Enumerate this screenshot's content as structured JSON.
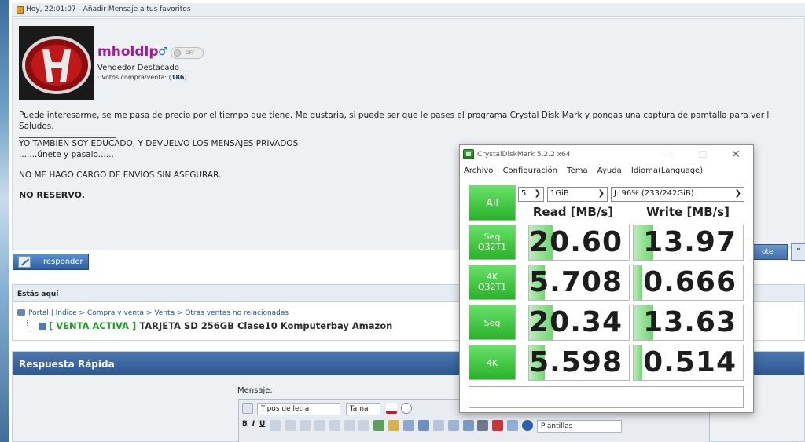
{
  "post": {
    "timestamp": "Hoy, 22:01:07 - Añadir Mensaje a tus favoritos",
    "username": "mholdlp",
    "gender_symbol": "♂",
    "online_status": "OFF",
    "user_title": "Vendedor Destacado",
    "votes_label": "· Votos compra/venta: (",
    "votes_count": "186",
    "votes_close": ")",
    "body_line1": "Puede interesarme, se me pasa de precio por el tiempo que tiene. Me gustaria, si puede ser que le pases el programa Crystal Disk Mark y pongas una captura de pamtalla para ver l",
    "body_line2": "Saludos.",
    "sig_line1": "YO TAMBIÉN SOY EDUCADO, Y DEVUELVO LOS MENSAJES PRIVADOS",
    "sig_line2": ".......únete y pasalo......",
    "sig_line3": "NO ME HAGO CARGO DE ENVÍOS SIN ASEGURAR.",
    "sig_line4": "NO RESERVO.",
    "quote_label": "ote",
    "multiquote_label": "\""
  },
  "reply_button": "responder",
  "breadcrumb": {
    "heading": "Estás aquí",
    "path": "Portal | Indice > Compra y venta > Venta > Otras ventas no relacionadas",
    "thread_status": "[ VENTA ACTIVA ]",
    "thread_title": " TARJETA SD 256GB Clase10 Komputerbay Amazon"
  },
  "quick_reply": {
    "heading": "Respuesta Rápida",
    "message_label": "Mensaje:",
    "font_select": "Tipos de letra",
    "size_select": "Tama",
    "templates_select": "Plantillas",
    "bold": "B",
    "italic": "I",
    "underline": "U"
  },
  "crystaldiskmark": {
    "title": "CrystalDiskMark 5.2.2 x64",
    "menu": [
      "Archivo",
      "Configuración",
      "Tema",
      "Ayuda",
      "Idioma(Language)"
    ],
    "all_button": "All",
    "count_select": "5",
    "size_select": "1GiB",
    "drive_select": "J: 96% (233/242GiB)",
    "read_header": "Read [MB/s]",
    "write_header": "Write [MB/s]",
    "rows": [
      {
        "label_line1": "Seq",
        "label_line2": "Q32T1",
        "read": "20.60",
        "write": "13.97",
        "read_fill": 0.24,
        "write_fill": 0.18
      },
      {
        "label_line1": "4K",
        "label_line2": "Q32T1",
        "read": "5.708",
        "write": "0.666",
        "read_fill": 0.16,
        "write_fill": 0.08
      },
      {
        "label_line1": "Seq",
        "label_line2": "",
        "read": "20.34",
        "write": "13.63",
        "read_fill": 0.24,
        "write_fill": 0.18
      },
      {
        "label_line1": "4K",
        "label_line2": "",
        "read": "5.598",
        "write": "0.514",
        "read_fill": 0.16,
        "write_fill": 0.08
      }
    ],
    "comment": ""
  }
}
